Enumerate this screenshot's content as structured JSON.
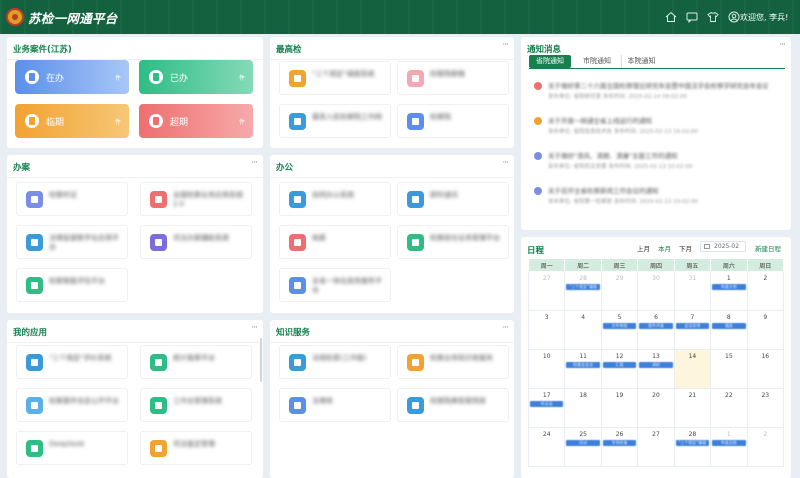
{
  "app": {
    "title": "苏检一网通平台",
    "user": "欢迎您, 李兵!"
  },
  "header_icons": [
    "home-icon",
    "message-icon",
    "shirt-icon",
    "user-circle-icon"
  ],
  "business": {
    "title": "业务案件(江苏)",
    "more": "···",
    "cards": [
      {
        "label": "在办",
        "unit": "件",
        "color_from": "#5b8fea",
        "color_to": "#a7c7f7",
        "icon": "document-icon"
      },
      {
        "label": "已办",
        "unit": "件",
        "color_from": "#2ebd84",
        "color_to": "#84dab8",
        "icon": "check-document-icon"
      },
      {
        "label": "临期",
        "unit": "件",
        "color_from": "#f2a231",
        "color_to": "#f7c777",
        "icon": "clock-document-icon"
      },
      {
        "label": "超期",
        "unit": "件",
        "color_from": "#ee6f6f",
        "color_to": "#f7a9a9",
        "icon": "alert-document-icon"
      }
    ]
  },
  "zuigaojian": {
    "title": "最高检",
    "more": "···",
    "tiles": [
      {
        "name": "\"三个规定\"填报系统",
        "color": "#f2a231",
        "icon": "form-icon"
      },
      {
        "name": "检察院邮箱",
        "color": "#f5a7b4",
        "icon": "mail-icon"
      },
      {
        "name": "最高人民检察院工作网",
        "color": "#3a9bdc",
        "icon": "globe-icon"
      },
      {
        "name": "检察院",
        "color": "#5b8fea",
        "icon": "shield-icon"
      }
    ]
  },
  "banan": {
    "title": "办案",
    "more": "···",
    "tiles": [
      {
        "name": "检察听证",
        "color": "#7c8de8",
        "icon": "dashboard-icon"
      },
      {
        "name": "全国检察业务应用系统2.0",
        "color": "#ee6f6f",
        "icon": "grid-icon"
      },
      {
        "name": "法律监督数字化应用平台",
        "color": "#3a9bdc",
        "icon": "report-icon"
      },
      {
        "name": "司法办案辅助系统",
        "color": "#7b6de0",
        "icon": "document-lines-icon"
      },
      {
        "name": "检察智能评估平台",
        "color": "#2ebd84",
        "icon": "check-square-icon"
      }
    ]
  },
  "bangong": {
    "title": "办公",
    "more": "···",
    "tiles": [
      {
        "name": "协同办公系统",
        "color": "#3a9bdc",
        "icon": "inbox-icon"
      },
      {
        "name": "即时通讯",
        "color": "#3a9bdc",
        "icon": "building-icon"
      },
      {
        "name": "档案",
        "color": "#ee6f6f",
        "icon": "folder-icon"
      },
      {
        "name": "检察综合业务管理平台",
        "color": "#2ebd84",
        "icon": "graduation-icon"
      },
      {
        "name": "全省一体化政务服务平台",
        "color": "#5b8fea",
        "icon": "location-icon"
      }
    ]
  },
  "notice": {
    "title": "通知消息",
    "more": "···",
    "tabs": [
      {
        "label": "省院通知",
        "active": true
      },
      {
        "label": "市院通知",
        "active": false
      },
      {
        "label": "本院通知",
        "active": false
      }
    ],
    "items": [
      {
        "title": "关于做好第二十六届全国检察理论研究年会暨中国法学会检察学研究会年会论文征集工作的通知",
        "meta": "发布单位: 省院研究室      发布时间: 2025-02-14 09:02:00",
        "color": "#ee6f6f"
      },
      {
        "title": "关于开展一网通全省上线运行的通知",
        "meta": "发布单位: 省院信息技术处      发布时间: 2025-02-13 16:02:00",
        "color": "#f2a231"
      },
      {
        "title": "关于做好\"清风、清朗、清廉\"主题工作的通知",
        "meta": "发布单位: 省院机关党委      发布时间: 2025-02-13 10:02:00",
        "color": "#7c8de8"
      },
      {
        "title": "关于召开全省检察新闻工作会议的通知",
        "meta": "发布单位: 省院第一检察部      发布时间: 2025-02-13 10:02:00",
        "color": "#7c8de8"
      }
    ]
  },
  "apps": {
    "title": "我的应用",
    "more": "···",
    "tiles": [
      {
        "name": "\"三个规定\"评价系统",
        "color": "#3a9bdc",
        "icon": "browser-icon"
      },
      {
        "name": "统计报表平台",
        "color": "#2ebd84",
        "icon": "doc-icon"
      },
      {
        "name": "检察案件信息公开平台",
        "color": "#5bb0e8",
        "icon": "cube-icon"
      },
      {
        "name": "工作台管理系统",
        "color": "#2ebd84",
        "icon": "swap-icon"
      },
      {
        "name": "DeepSeek",
        "color": "#2ebd84",
        "icon": "nodes-icon"
      },
      {
        "name": "司法鉴定管理",
        "color": "#f2a231",
        "icon": "award-icon"
      }
    ]
  },
  "knowledge": {
    "title": "知识服务",
    "more": "···",
    "tiles": [
      {
        "name": "法规检索(工作版)",
        "color": "#3a9bdc",
        "icon": "edit-icon"
      },
      {
        "name": "检察业务知识库服务",
        "color": "#f2a231",
        "icon": "book-icon"
      },
      {
        "name": "法律库",
        "color": "#5b8fea",
        "icon": "globe-icon"
      },
      {
        "name": "检察院典型案例库",
        "color": "#3a9bdc",
        "icon": "archive-icon"
      }
    ]
  },
  "schedule": {
    "title": "日程",
    "prev": "上月",
    "current": "本月",
    "next": "下月",
    "month": "2025-02",
    "new": "新建日程",
    "weekdays": [
      "周一",
      "周二",
      "周三",
      "周四",
      "周五",
      "周六",
      "周日"
    ],
    "weeks": [
      [
        {
          "d": "27",
          "dim": true
        },
        {
          "d": "28",
          "dim": true,
          "ev": [
            "\"三个规定\"填报"
          ]
        },
        {
          "d": "29",
          "dim": true
        },
        {
          "d": "30",
          "dim": true
        },
        {
          "d": "31",
          "dim": true
        },
        {
          "d": "1",
          "ev": [
            "年度计划"
          ]
        },
        {
          "d": "2"
        }
      ],
      [
        {
          "d": "3"
        },
        {
          "d": "4"
        },
        {
          "d": "5",
          "ev": [
            "文件审批"
          ]
        },
        {
          "d": "6",
          "ev": [
            "案件评查"
          ]
        },
        {
          "d": "7",
          "ev": [
            "会议安排"
          ]
        },
        {
          "d": "8",
          "ev": [
            "值班"
          ]
        },
        {
          "d": "9"
        }
      ],
      [
        {
          "d": "10"
        },
        {
          "d": "11",
          "ev": [
            "检委会会议"
          ]
        },
        {
          "d": "12",
          "ev": [
            "汇报"
          ]
        },
        {
          "d": "13",
          "ev": [
            "调研"
          ]
        },
        {
          "d": "14",
          "today": true
        },
        {
          "d": "15"
        },
        {
          "d": "16"
        }
      ],
      [
        {
          "d": "17",
          "ev": [
            "听证会"
          ]
        },
        {
          "d": "18"
        },
        {
          "d": "19"
        },
        {
          "d": "20"
        },
        {
          "d": "21"
        },
        {
          "d": "22"
        },
        {
          "d": "23"
        }
      ],
      [
        {
          "d": "24"
        },
        {
          "d": "25",
          "ev": [
            "培训"
          ]
        },
        {
          "d": "26",
          "ev": [
            "专项检查"
          ]
        },
        {
          "d": "27"
        },
        {
          "d": "28",
          "ev": [
            "\"三个规定\"填报"
          ]
        },
        {
          "d": "1",
          "dim": true,
          "ev": [
            "年度总结"
          ]
        },
        {
          "d": "2",
          "dim": true
        }
      ]
    ]
  }
}
